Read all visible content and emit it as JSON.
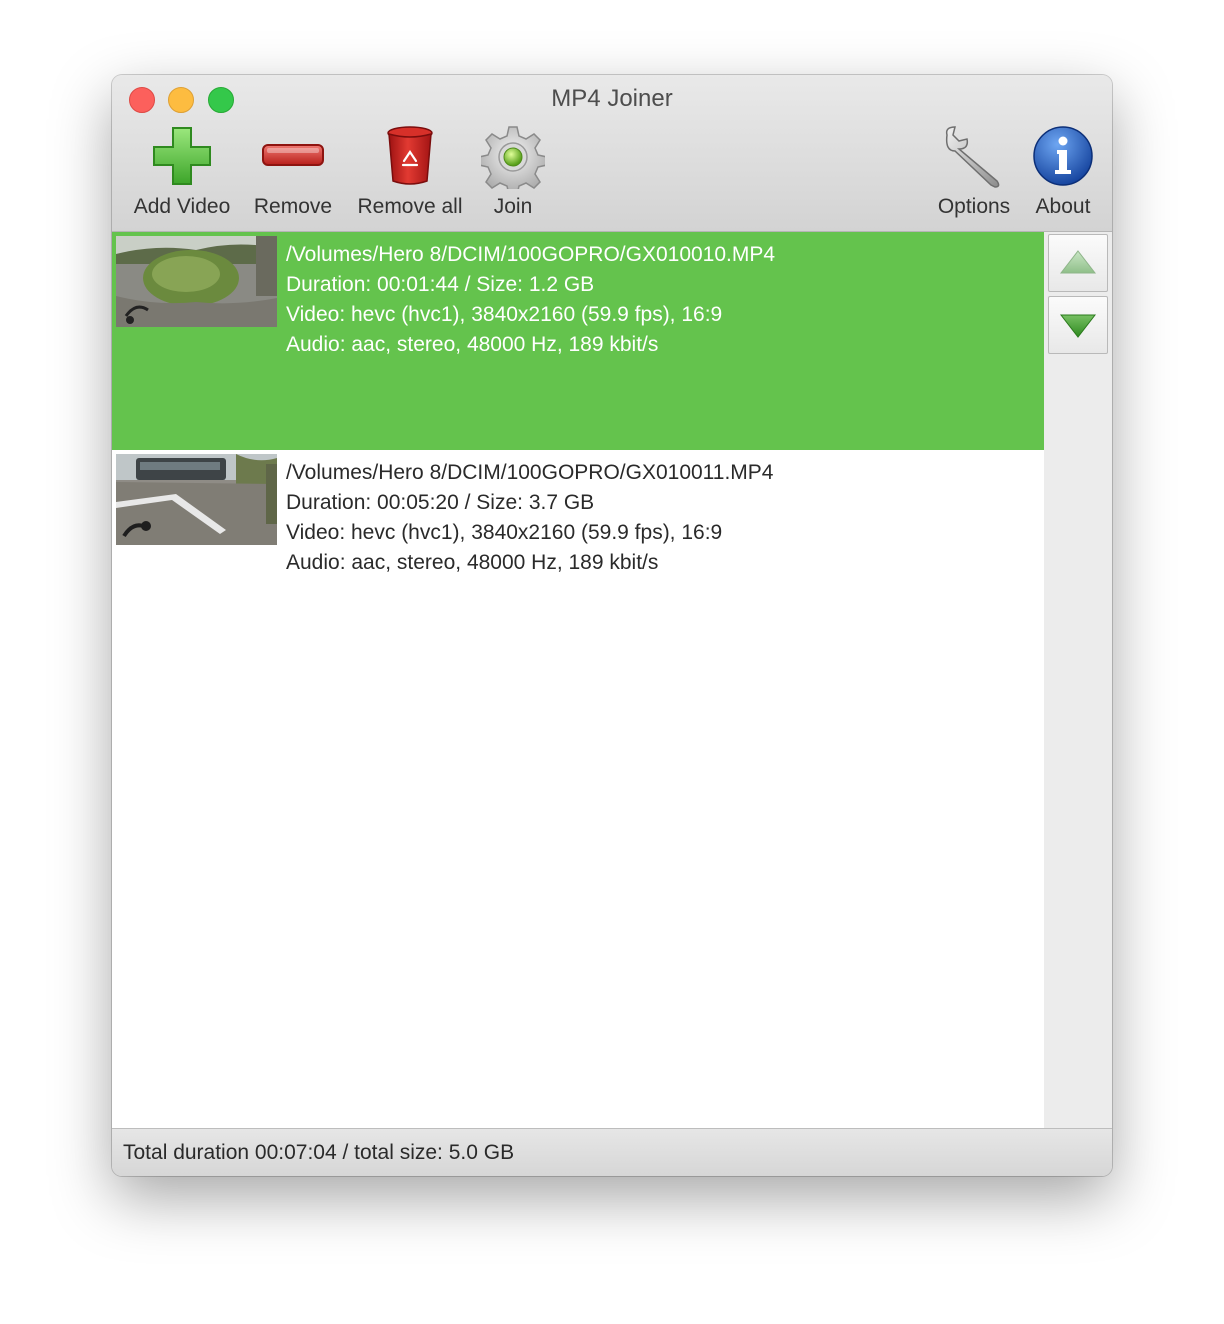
{
  "window": {
    "title": "MP4 Joiner"
  },
  "toolbar": {
    "add_label": "Add Video",
    "remove_label": "Remove",
    "remove_all_label": "Remove all",
    "join_label": "Join",
    "options_label": "Options",
    "about_label": "About"
  },
  "files": [
    {
      "path": "/Volumes/Hero 8/DCIM/100GOPRO/GX010010.MP4",
      "duration_size": "Duration: 00:01:44 / Size: 1.2 GB",
      "video": "Video: hevc (hvc1), 3840x2160 (59.9 fps), 16:9",
      "audio": "Audio: aac, stereo, 48000 Hz, 189 kbit/s",
      "selected": true
    },
    {
      "path": "/Volumes/Hero 8/DCIM/100GOPRO/GX010011.MP4",
      "duration_size": "Duration: 00:05:20 / Size: 3.7 GB",
      "video": "Video: hevc (hvc1), 3840x2160 (59.9 fps), 16:9",
      "audio": "Audio: aac, stereo, 48000 Hz, 189 kbit/s",
      "selected": false
    }
  ],
  "status": {
    "text": "Total duration 00:07:04 / total size: 5.0 GB"
  },
  "colors": {
    "selection": "#64c34d",
    "accent_green": "#3fa52c",
    "trash_red": "#c81e1e",
    "info_blue": "#1f5fc6"
  },
  "icons": [
    "plus-icon",
    "minus-icon",
    "trash-icon",
    "gear-icon",
    "wrench-icon",
    "info-icon",
    "arrow-up-icon",
    "arrow-down-icon"
  ]
}
